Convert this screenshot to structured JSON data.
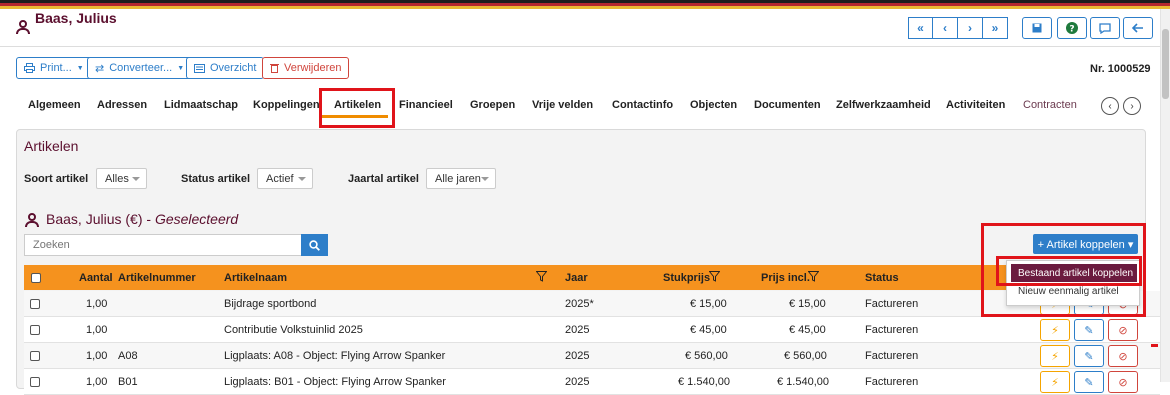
{
  "header": {
    "title": "Baas, Julius",
    "nav_buttons": [
      "«",
      "‹",
      "›",
      "»"
    ],
    "action_icons": [
      "save-icon",
      "help-icon",
      "comment-icon",
      "back-icon"
    ]
  },
  "toolbar": {
    "print_label": "Print...",
    "convert_label": "Converteer...",
    "overview_label": "Overzicht",
    "delete_label": "Verwijderen",
    "record_number": "Nr. 1000529"
  },
  "tabs": [
    {
      "label": "Algemeen"
    },
    {
      "label": "Adressen"
    },
    {
      "label": "Lidmaatschap"
    },
    {
      "label": "Koppelingen"
    },
    {
      "label": "Artikelen"
    },
    {
      "label": "Financieel"
    },
    {
      "label": "Groepen"
    },
    {
      "label": "Vrije velden"
    },
    {
      "label": "Contactinfo"
    },
    {
      "label": "Objecten"
    },
    {
      "label": "Documenten"
    },
    {
      "label": "Zelfwerkzaamheid"
    },
    {
      "label": "Activiteiten"
    },
    {
      "label": "Contracten"
    }
  ],
  "active_tab": "Artikelen",
  "panel": {
    "title": "Artikelen",
    "filters": {
      "soort_label": "Soort artikel",
      "soort_value": "Alles",
      "status_label": "Status artikel",
      "status_value": "Actief",
      "jaartal_label": "Jaartal artikel",
      "jaartal_value": "Alle jaren"
    },
    "selected_name": "Baas, Julius (€)",
    "selected_dash": "-",
    "selected_status": "Geselecteerd",
    "search_placeholder": "Zoeken",
    "koppel_button": "+ Artikel koppelen ▾",
    "dropdown": {
      "item1": "Bestaand artikel koppelen",
      "item2": "Nieuw eenmalig artikel"
    }
  },
  "table": {
    "columns": {
      "aantal": "Aantal",
      "artikelnummer": "Artikelnummer",
      "artikelnaam": "Artikelnaam",
      "jaar": "Jaar",
      "stukprijs": "Stukprijs",
      "prijs_incl": "Prijs incl.",
      "status": "Status"
    },
    "rows": [
      {
        "aantal": "1,00",
        "nummer": "",
        "naam": "Bijdrage sportbond",
        "jaar": "2025*",
        "stukprijs": "€ 15,00",
        "prijs": "€ 15,00",
        "status": "Factureren"
      },
      {
        "aantal": "1,00",
        "nummer": "",
        "naam": "Contributie Volkstuinlid 2025",
        "jaar": "2025",
        "stukprijs": "€ 45,00",
        "prijs": "€ 45,00",
        "status": "Factureren"
      },
      {
        "aantal": "1,00",
        "nummer": "A08",
        "naam": "Ligplaats: A08 - Object: Flying Arrow Spanker",
        "jaar": "2025",
        "stukprijs": "€ 560,00",
        "prijs": "€ 560,00",
        "status": "Factureren"
      },
      {
        "aantal": "1,00",
        "nummer": "B01",
        "naam": "Ligplaats: B01 - Object: Flying Arrow Spanker",
        "jaar": "2025",
        "stukprijs": "€ 1.540,00",
        "prijs": "€ 1.540,00",
        "status": "Factureren"
      }
    ]
  },
  "colors": {
    "brand": "#5b0f2e",
    "accent": "#2d7ec9",
    "table_header": "#f5921e",
    "danger": "#d0453c",
    "highlight": "#e0141a"
  }
}
